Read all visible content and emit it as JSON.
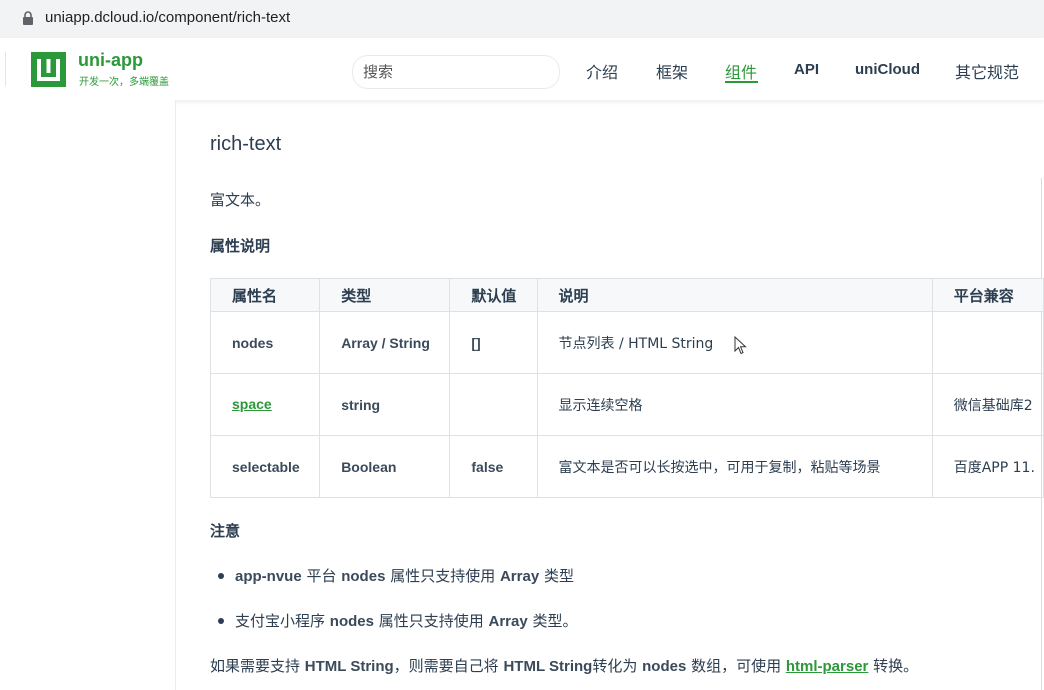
{
  "browser": {
    "url": "uniapp.dcloud.io/component/rich-text"
  },
  "header": {
    "brand": "uni-app",
    "tagline": "开发一次，多端覆盖",
    "search_placeholder": "搜索",
    "nav": [
      "介绍",
      "框架",
      "组件",
      "API",
      "uniCloud",
      "其它规范"
    ],
    "active_nav": "组件",
    "accent_color": "#2b9939"
  },
  "main": {
    "title": "rich-text",
    "description": "富文本。",
    "props_heading": "属性说明",
    "table": {
      "headers": [
        "属性名",
        "类型",
        "默认值",
        "说明",
        "平台兼容"
      ],
      "rows": [
        [
          "nodes",
          "Array / String",
          "[]",
          "节点列表 / HTML String",
          ""
        ],
        [
          "space",
          "string",
          "",
          "显示连续空格",
          "微信基础库2"
        ],
        [
          "selectable",
          "Boolean",
          "false",
          "富文本是否可以长按选中，可用于复制，粘贴等场景",
          "百度APP 11."
        ]
      ]
    },
    "note_heading": "注意",
    "notes": [
      {
        "p1": "app-nvue",
        "p2": " 平台 ",
        "p3": "nodes",
        "p4": " 属性只支持使用 ",
        "p5": "Array",
        "p6": " 类型"
      },
      {
        "p1": "支付宝小程序 ",
        "p2": "nodes",
        "p3": " 属性只支持使用 ",
        "p4": "Array",
        "p5": " 类型。"
      }
    ],
    "final": {
      "t1": "如果需要支持 ",
      "t2": "HTML String",
      "t3": "，则需要自己将 ",
      "t4": "HTML String",
      "t5": "转化为 ",
      "t6": "nodes",
      "t7": " 数组，可使用 ",
      "t8": "html-parser",
      "t9": " 转换。"
    }
  }
}
